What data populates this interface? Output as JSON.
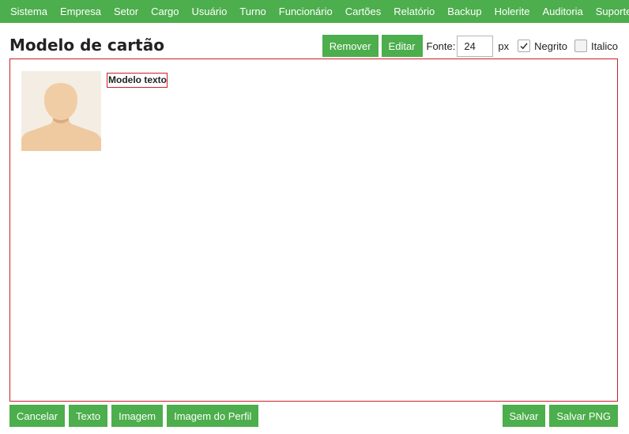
{
  "menu": {
    "items": [
      {
        "label": "Sistema"
      },
      {
        "label": "Empresa"
      },
      {
        "label": "Setor"
      },
      {
        "label": "Cargo"
      },
      {
        "label": "Usuário"
      },
      {
        "label": "Turno"
      },
      {
        "label": "Funcionário"
      },
      {
        "label": "Cartões"
      },
      {
        "label": "Relatório"
      },
      {
        "label": "Backup"
      },
      {
        "label": "Holerite"
      },
      {
        "label": "Auditoria"
      },
      {
        "label": "Suporte"
      }
    ]
  },
  "page": {
    "title": "Modelo de cartão"
  },
  "toolbar": {
    "remove_label": "Remover",
    "edit_label": "Editar",
    "font_label": "Fonte:",
    "font_size_value": "24",
    "font_unit": "px",
    "bold_label": "Negrito",
    "bold_checked": true,
    "italic_label": "Italico",
    "italic_checked": false
  },
  "canvas": {
    "text_element": "Modelo texto",
    "avatar_icon": "profile-placeholder-icon"
  },
  "bottom": {
    "cancel_label": "Cancelar",
    "text_label": "Texto",
    "image_label": "Imagem",
    "profile_image_label": "Imagem do Perfil",
    "save_label": "Salvar",
    "save_png_label": "Salvar PNG"
  },
  "colors": {
    "accent_green": "#4cae4c",
    "canvas_border_red": "#cc1f2a",
    "avatar_background": "#f3ede3",
    "avatar_skin": "#f0cda4"
  }
}
